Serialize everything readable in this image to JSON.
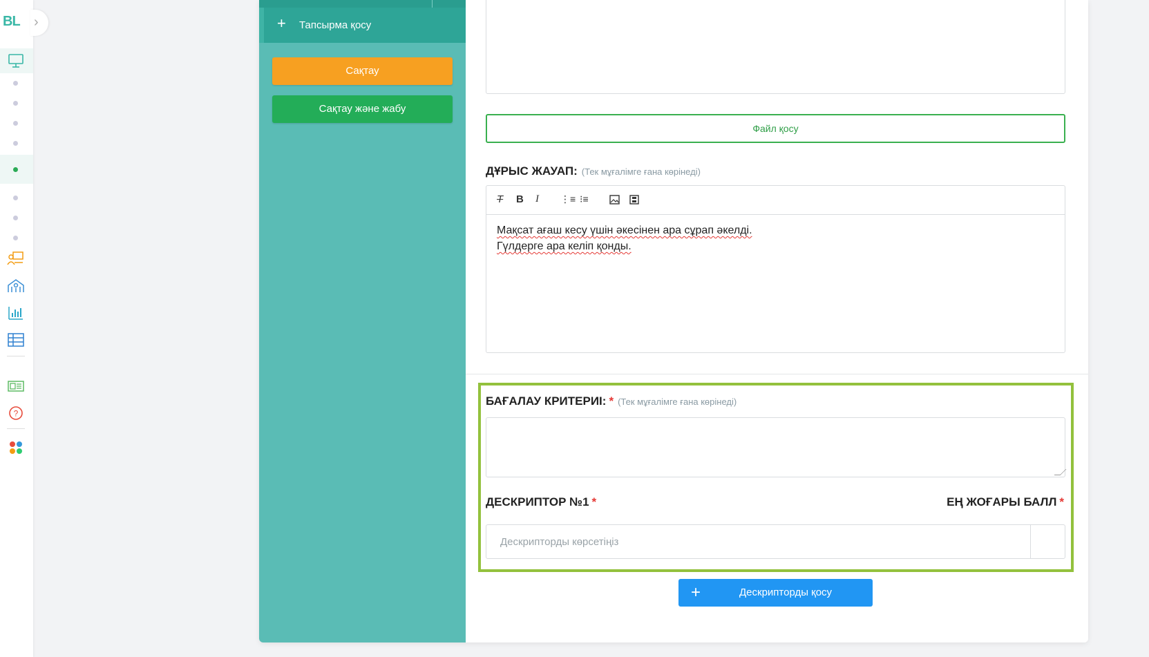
{
  "rail": {
    "logo": "BL",
    "icons": [
      "monitor-icon",
      "teacher-icon",
      "school-icon",
      "bar-chart-icon",
      "table-icon",
      "id-card-icon",
      "help-icon",
      "apps-icon"
    ]
  },
  "sidebar": {
    "add_task_label": "Тапсырма қосу",
    "save_label": "Сақтау",
    "save_close_label": "Сақтау және жабу"
  },
  "main": {
    "file_button_label": "Файл қосу",
    "answer_label": "ДҰРЫС ЖАУАП:",
    "answer_hint": "(Тек мұғалімге ғана көрінеді)",
    "answer_lines": [
      "Мақсат ағаш кесу үшін әкесінен ара сұрап әкелді.",
      "Гүлдерге ара келіп қонды."
    ],
    "criteria_label": "БАҒАЛАУ КРИТЕРИІ:",
    "criteria_required": "*",
    "criteria_hint": "(Тек мұғалімге ғана көрінеді)",
    "descriptor_label": "ДЕСКРИПТОР №1",
    "descriptor_required": "*",
    "max_score_label": "ЕҢ ЖОҒАРЫ БАЛЛ",
    "max_score_required": "*",
    "descriptor_placeholder": "Дескрипторды көрсетіңіз",
    "add_descriptor_label": "Дескрипторды қосу"
  },
  "colors": {
    "teal_sidebar": "#5abcb5",
    "teal_dark": "#2ea597",
    "orange": "#f7a021",
    "green": "#23ad58",
    "highlight": "#93c13d",
    "blue": "#2196f3"
  }
}
